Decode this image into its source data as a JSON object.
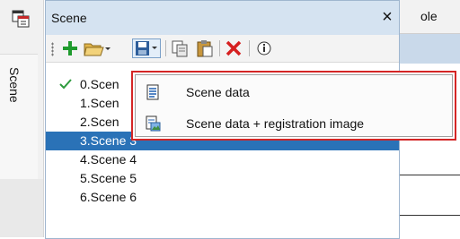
{
  "left_strip": {
    "tab_label": "Scene"
  },
  "background_pane": {
    "header_text": "ole"
  },
  "panel": {
    "title": "Scene",
    "close_glyph": "×",
    "toolbar": {
      "buttons": [
        "add-icon",
        "open-folder-icon",
        "save-icon",
        "copy-icon",
        "paste-icon",
        "delete-icon",
        "info-icon"
      ]
    },
    "list": [
      {
        "label": "0.Scen",
        "checked": true
      },
      {
        "label": "1.Scen"
      },
      {
        "label": "2.Scen"
      },
      {
        "label": "3.Scene 3",
        "selected": true
      },
      {
        "label": "4.Scene 4"
      },
      {
        "label": "5.Scene 5"
      },
      {
        "label": "6.Scene 6"
      }
    ]
  },
  "dropdown": {
    "items": [
      {
        "label": "Scene data",
        "icon": "document-icon"
      },
      {
        "label": "Scene data + registration image",
        "icon": "image-document-icon"
      }
    ]
  },
  "colors": {
    "selection": "#2a72b7",
    "titlebar": "#d5e3f1",
    "menu_border": "#d42525",
    "add": "#1f9b2e",
    "delete": "#d62020"
  }
}
